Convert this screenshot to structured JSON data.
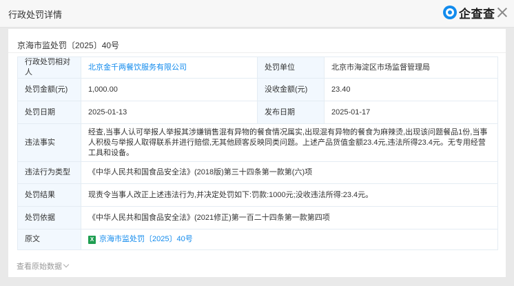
{
  "header": {
    "title": "行政处罚详情",
    "logo_text": "企查查",
    "close_icon": "close-icon",
    "brand_color": "#128bed"
  },
  "case": {
    "title": "京海市监处罚〔2025〕40号"
  },
  "table": {
    "row1": {
      "label_a": "行政处罚相对人",
      "value_a": "北京金千两餐饮服务有限公司",
      "label_b": "处罚单位",
      "value_b": "北京市海淀区市场监督管理局"
    },
    "row2": {
      "label_a": "处罚金额(元)",
      "value_a": "1,000.00",
      "label_b": "没收金额(元)",
      "value_b": "23.40"
    },
    "row3": {
      "label_a": "处罚日期",
      "value_a": "2025-01-13",
      "label_b": "发布日期",
      "value_b": "2025-01-17"
    },
    "facts": {
      "label": "违法事实",
      "value": "经查,当事人认可举报人举报其涉嫌销售混有异物的餐食情况属实,出现混有异物的餐食为麻辣烫,出现该问题餐品1份,当事人积极与举报人取得联系并进行赔偿,无其他顾客反映同类问题。上述产品货值金额23.4元,违法所得23.4元。无专用经营工具和设备。"
    },
    "violation_type": {
      "label": "违法行为类型",
      "value": "《中华人民共和国食品安全法》(2018版)第三十四条第一款第(六)项"
    },
    "result": {
      "label": "处罚结果",
      "value": "现责令当事人改正上述违法行为,并决定处罚如下:罚款:1000元;没收违法所得:23.4元。"
    },
    "basis": {
      "label": "处罚依据",
      "value": "《中华人民共和国食品安全法》(2021修正)第一百二十四条第一款第四项"
    },
    "original": {
      "label": "原文",
      "value": "京海市监处罚〔2025〕40号",
      "icon": "excel-file-icon"
    }
  },
  "footer": {
    "view_raw_label": "查看原始数据"
  }
}
